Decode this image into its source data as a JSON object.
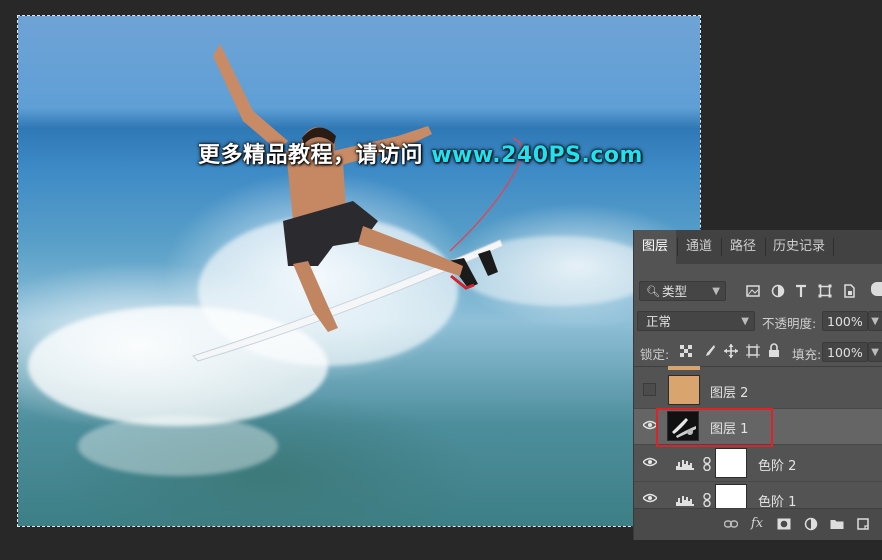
{
  "watermark": {
    "text_cn": "更多精品教程，请访问",
    "text_url": "www.240PS.com"
  },
  "layers_panel": {
    "tabs": [
      {
        "label": "图层",
        "active": true
      },
      {
        "label": "通道",
        "active": false
      },
      {
        "label": "路径",
        "active": false
      },
      {
        "label": "历史记录",
        "active": false
      }
    ],
    "filter": {
      "label": "类型",
      "icon": "search-icon"
    },
    "filter_icons": [
      "image-filter-icon",
      "adjustment-filter-icon",
      "type-filter-icon",
      "shape-filter-icon",
      "smart-object-filter-icon"
    ],
    "blend_mode": "正常",
    "opacity_label": "不透明度:",
    "opacity_value": "100%",
    "lock_label": "锁定:",
    "lock_icons": [
      "lock-transparent-icon",
      "lock-image-icon",
      "lock-position-icon",
      "lock-artboard-icon",
      "lock-all-icon"
    ],
    "fill_label": "填充:",
    "fill_value": "100%",
    "layers": [
      {
        "name": "图层 2",
        "visible": false,
        "thumb_color": "#d9a46e"
      },
      {
        "name": "图层 1",
        "visible": true,
        "selected": true
      },
      {
        "name": "色阶 2",
        "visible": true,
        "type": "levels"
      },
      {
        "name": "色阶 1",
        "visible": true,
        "type": "levels"
      }
    ],
    "footer_icons": [
      "link-icon",
      "fx-icon",
      "mask-icon",
      "adjustment-icon",
      "folder-icon",
      "new-layer-icon"
    ],
    "footer_fx_label": "fx"
  },
  "colors": {
    "highlight_box": "#e2202a",
    "watermark_url": "#22e0ee"
  }
}
